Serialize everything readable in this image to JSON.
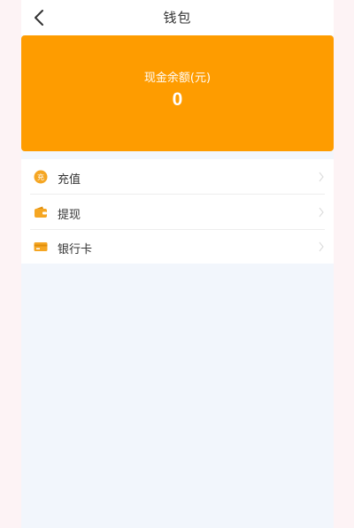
{
  "header": {
    "title": "钱包"
  },
  "balance": {
    "label": "现金余额(元)",
    "value": "0"
  },
  "menu": {
    "items": [
      {
        "label": "充值",
        "icon": "recharge-icon",
        "icon_text": "充"
      },
      {
        "label": "提现",
        "icon": "wallet-icon"
      },
      {
        "label": "银行卡",
        "icon": "bank-card-icon"
      }
    ]
  },
  "colors": {
    "accent": "#fe9c00",
    "background": "#f2f6fc"
  }
}
